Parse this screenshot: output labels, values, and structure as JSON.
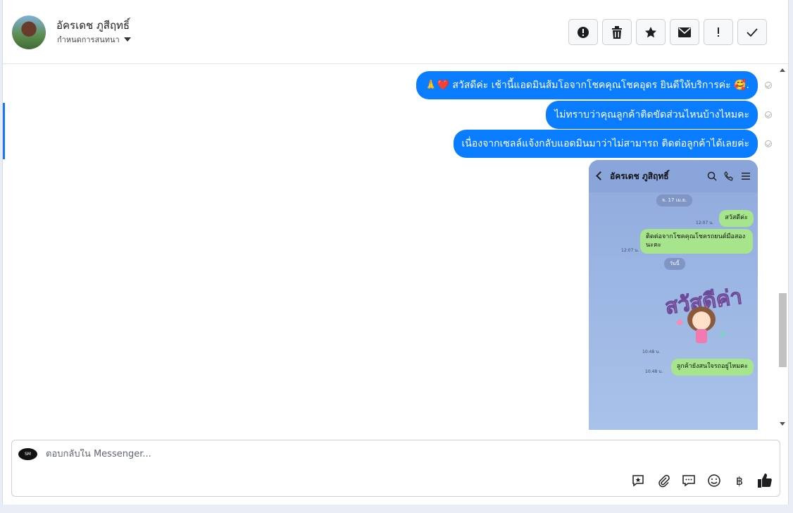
{
  "header": {
    "contact_name": "อัครเดช ภูสีฤทธิ์",
    "assign_label": "กำหนดการสนทนา",
    "toolbar_icons": [
      "alert-circle-icon",
      "trash-icon",
      "star-icon",
      "envelope-icon",
      "exclamation-icon",
      "check-icon"
    ]
  },
  "messages": [
    {
      "text": "🙏❤️ สวัสดีค่ะ เช้านี้แอดมินส้มโอจากโชคคุณโชคอุดร ยินดีให้บริการค่ะ 🥰."
    },
    {
      "text": "ไม่ทราบว่าคุณลูกค้าติดขัดส่วนไหนบ้างไหมคะ"
    },
    {
      "text": "เนื่องจากเซลล์แจ้งกลับแอดมินมาว่าไม่สามารถ ติดต่อลูกค้าได้เลยค่ะ"
    }
  ],
  "screenshot": {
    "name": "อัครเดช ภูสิฤทธิ์",
    "date_pill": "จ. 17 เม.ย.",
    "today_pill": "วันนี้",
    "bubble1": "สวัสดีค่ะ",
    "time1": "12:07 น.",
    "bubble2": "ติดต่อจากโชคคุณโชครถยนต์มือสองนะคะ",
    "time2": "12:07 น.",
    "sticker_time": "10:48 น.",
    "bubble3": "ลูกค้ายังสนใจรถอยู่ไหมคะ",
    "time3": "10:48 น.",
    "sticker_text": "สวัสดีค่า"
  },
  "composer": {
    "placeholder": "ตอบกลับใน Messenger...",
    "logo_text": "SM",
    "tool_icons": [
      "quick-reply-icon",
      "attachment-icon",
      "saved-reply-icon",
      "emoji-icon",
      "baht-icon",
      "like-icon"
    ],
    "baht_symbol": "฿"
  },
  "colors": {
    "bubble": "#0a7cff",
    "line_bubble": "#a6e58c",
    "accent": "#1877f2"
  }
}
